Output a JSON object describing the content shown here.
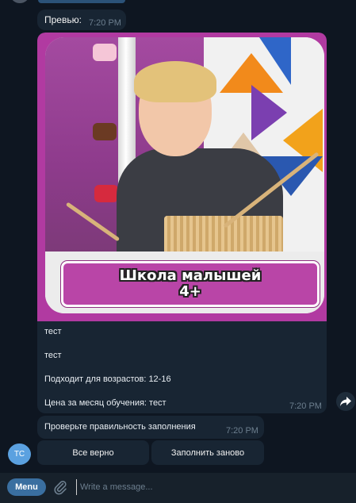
{
  "messages": {
    "preview": {
      "text": "Превью:",
      "time": "7:20 PM"
    },
    "media": {
      "banner_line1": "Школа малышей",
      "banner_line2": "4+",
      "captions": [
        "тест",
        "тест",
        "Подходит для возрастов: 12-16",
        "Цена за месяц обучения: тест"
      ],
      "time": "7:20 PM"
    },
    "check": {
      "text": "Проверьте правильность заполнения",
      "time": "7:20 PM"
    }
  },
  "avatar": {
    "initials": "TC",
    "color": "#5ba1e0"
  },
  "keyboard": {
    "button1": "Все верно",
    "button2": "Заполнить заново"
  },
  "composer": {
    "menu_label": "Menu",
    "placeholder": "Write a message..."
  },
  "icons": {
    "share": "share-arrow-icon",
    "attach": "paperclip-icon"
  },
  "colors": {
    "background": "#0e1621",
    "bubble": "#182533",
    "accent": "#3a6fa0",
    "banner": "#b945a7"
  }
}
